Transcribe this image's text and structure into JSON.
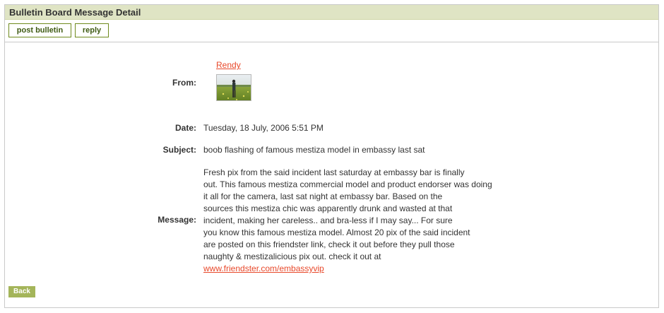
{
  "header": {
    "title": "Bulletin Board Message Detail"
  },
  "toolbar": {
    "post_label": "post bulletin",
    "reply_label": "reply"
  },
  "from": {
    "label": "From:",
    "name": "Rendy",
    "avatar_icon": "user-photo-thumbnail"
  },
  "date": {
    "label": "Date:",
    "value": "Tuesday, 18 July, 2006 5:51 PM"
  },
  "subject": {
    "label": "Subject:",
    "value": "boob flashing of famous mestiza model in embassy last sat"
  },
  "message": {
    "label": "Message:",
    "lines": [
      "Fresh pix from the said incident last saturday at embassy bar is finally",
      "out. This famous mestiza commercial model and product endorser was doing",
      "it all for the camera, last sat night at embassy bar. Based on the",
      "sources this mestiza chic was apparently drunk and wasted at that",
      "incident, making her careless.. and bra-less if I may say... For sure",
      "you know this famous mestiza model. Almost 20 pix of the said incident",
      "are posted on this friendster link, check it out before they pull those",
      "naughty & mestizalicious pix out. check it out at"
    ],
    "link": "www.friendster.com/embassyvip"
  },
  "footer": {
    "back_label": "Back"
  },
  "colors": {
    "header_bg": "#dfe4c4",
    "link": "#e8482a",
    "button_border": "#6f8a1e",
    "back_bg": "#a4b55a"
  }
}
